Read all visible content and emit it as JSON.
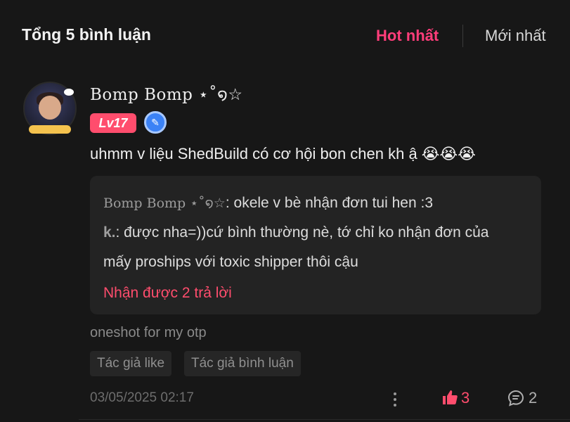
{
  "header": {
    "title": "Tổng 5 bình luận",
    "sort_hot": "Hot nhất",
    "sort_new": "Mới nhất"
  },
  "comment": {
    "username": "Bomp Bomp ⋆˚໑☆",
    "level": "Lv17",
    "text": "uhmm v liệu ShedBuild có cơ hội bon chen kh ậ 😭😭😭",
    "replies": [
      {
        "name": "Bomp Bomp ⋆˚໑☆",
        "text": ": okele v bè nhận đơn tui hen :3"
      },
      {
        "name": "k.",
        "text": ": được nha=))cứ bình thường nè, tớ chỉ ko nhận đơn của",
        "text_cont": "mấy proships với toxic shipper thôi cậu"
      }
    ],
    "more_replies": "Nhận được 2 trả lời",
    "caption": "oneshot for my otp",
    "tags": [
      "Tác giả like",
      "Tác giả bình luận"
    ],
    "timestamp": "03/05/2025 02:17",
    "likes": "3",
    "comments": "2"
  },
  "colors": {
    "accent": "#ff4d6d",
    "hot": "#ff3d7a",
    "background": "#171717",
    "reply_box": "#232323"
  },
  "icons": [
    "more-vertical-icon",
    "thumbs-up-icon",
    "comment-icon",
    "verified-pen-icon"
  ]
}
